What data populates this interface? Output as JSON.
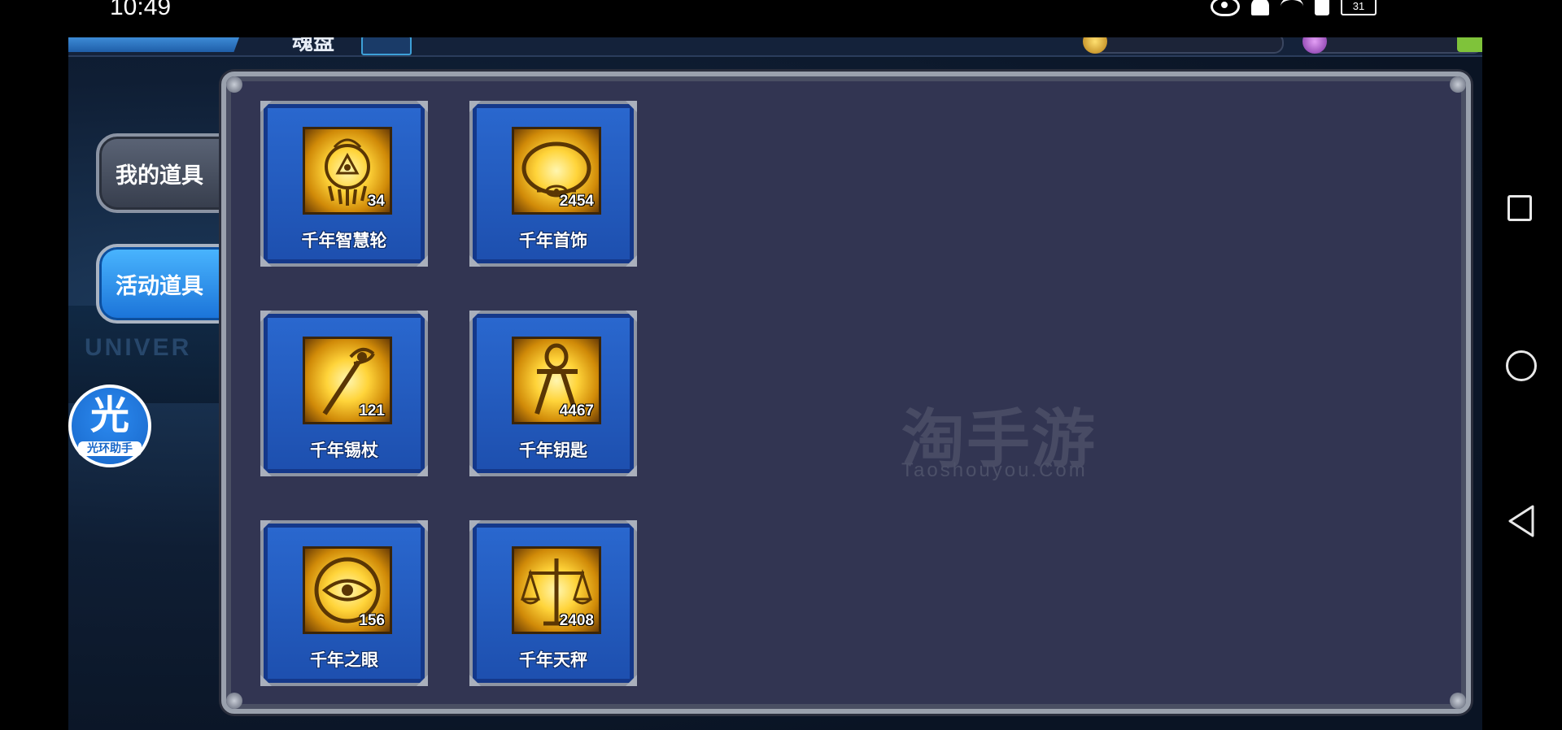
{
  "status_bar": {
    "time": "10:49",
    "battery": "31",
    "icons": [
      "eye-icon",
      "bell-off-icon",
      "wifi-icon",
      "sim-icon",
      "battery-icon"
    ]
  },
  "header": {
    "title": "魂盘"
  },
  "side_tabs": [
    {
      "label": "我的道具",
      "active": false
    },
    {
      "label": "活动道具",
      "active": true
    }
  ],
  "helper_button": {
    "glyph": "光",
    "label": "光环助手"
  },
  "items": [
    {
      "name": "千年智慧轮",
      "count": "34",
      "icon": "millennium-ring-icon"
    },
    {
      "name": "千年首饰",
      "count": "2454",
      "icon": "millennium-necklace-icon"
    },
    {
      "name": "千年锡杖",
      "count": "121",
      "icon": "millennium-rod-icon"
    },
    {
      "name": "千年钥匙",
      "count": "4467",
      "icon": "millennium-key-icon"
    },
    {
      "name": "千年之眼",
      "count": "156",
      "icon": "millennium-eye-icon"
    },
    {
      "name": "千年天秤",
      "count": "2408",
      "icon": "millennium-scale-icon"
    }
  ],
  "watermark": {
    "main": "淘手游",
    "sub": "Taoshouyou.Com"
  },
  "colors": {
    "panel_bg": "#323552",
    "card_blue": "#2a68cf",
    "active_tab": "#4ab6ff"
  }
}
